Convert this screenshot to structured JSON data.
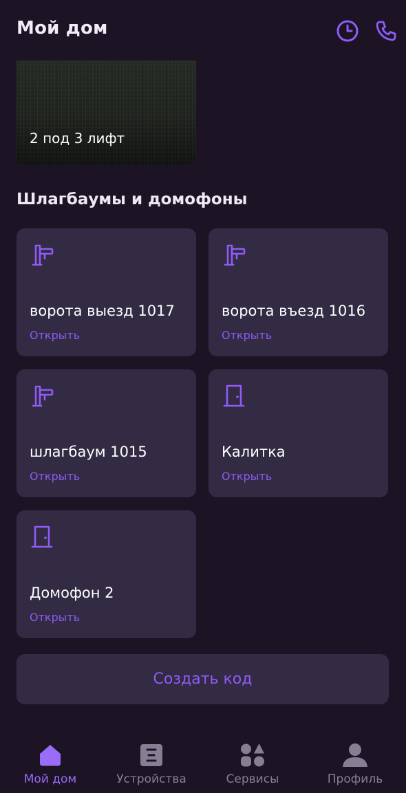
{
  "header": {
    "title": "Мой дом",
    "history_icon": "clock-icon",
    "call_icon": "phone-icon"
  },
  "camera": {
    "label": "2 под 3 лифт"
  },
  "section": {
    "title": "Шлагбаумы и домофоны"
  },
  "devices": [
    {
      "name": "ворота выезд 1017",
      "action": "Открыть",
      "icon": "barrier-icon"
    },
    {
      "name": "ворота въезд 1016",
      "action": "Открыть",
      "icon": "barrier-icon"
    },
    {
      "name": "шлагбаум 1015",
      "action": "Открыть",
      "icon": "barrier-icon"
    },
    {
      "name": "Калитка",
      "action": "Открыть",
      "icon": "door-icon"
    },
    {
      "name": "Домофон 2",
      "action": "Открыть",
      "icon": "door-icon"
    }
  ],
  "create_code": {
    "label": "Создать код"
  },
  "tabbar": {
    "items": [
      {
        "label": "Мой дом",
        "icon": "home-icon",
        "active": true
      },
      {
        "label": "Устройства",
        "icon": "devices-icon",
        "active": false
      },
      {
        "label": "Сервисы",
        "icon": "services-icon",
        "active": false
      },
      {
        "label": "Профиль",
        "icon": "profile-icon",
        "active": false
      }
    ]
  },
  "colors": {
    "background": "#1c1425",
    "card": "#332a44",
    "accent": "#8f5cf5",
    "inactive": "#877e94"
  }
}
